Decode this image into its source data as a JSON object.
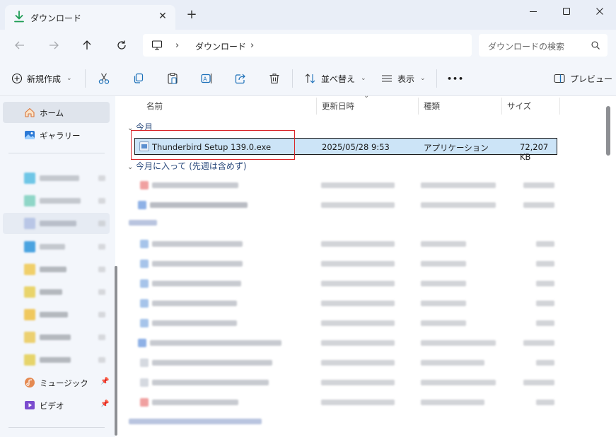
{
  "window": {
    "tab_title": "ダウンロード",
    "new_tab_label": "+"
  },
  "address": {
    "segment": "ダウンロード",
    "search_placeholder": "ダウンロードの検索"
  },
  "commands": {
    "new": "新規作成",
    "sort": "並べ替え",
    "view": "表示",
    "more": "•••",
    "preview": "プレビュー"
  },
  "sidebar": {
    "home": "ホーム",
    "gallery": "ギャラリー",
    "music": "ミュージック",
    "video": "ビデオ"
  },
  "columns": {
    "name": "名前",
    "modified": "更新日時",
    "type": "種類",
    "size": "サイズ"
  },
  "groups": {
    "today": "今月",
    "earlier": "今月に入って (先週は含めず)"
  },
  "selected_file": {
    "name": "Thunderbird Setup 139.0.exe",
    "modified": "2025/05/28 9:53",
    "type": "アプリケーション",
    "size": "72,207 KB"
  },
  "colors": {
    "accent": "#0067c0",
    "selection": "#cce4f7",
    "annotation": "#d9262a",
    "download_green": "#1f9d55"
  }
}
